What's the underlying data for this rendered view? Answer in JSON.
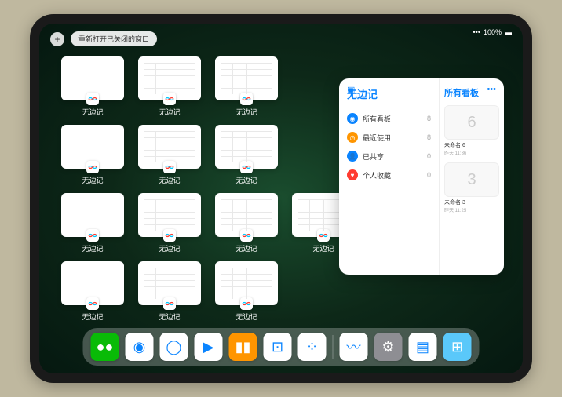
{
  "status": {
    "battery": "100%",
    "signal": "●●●●"
  },
  "topbar": {
    "plus": "+",
    "reopen": "重新打开已关闭的窗口"
  },
  "app": {
    "name": "无边记"
  },
  "windows": [
    {
      "label": "无边记",
      "style": "blank"
    },
    {
      "label": "无边记",
      "style": "lines"
    },
    {
      "label": "无边记",
      "style": "lines"
    },
    {
      "label": "无边记",
      "style": "blank"
    },
    {
      "label": "无边记",
      "style": "lines"
    },
    {
      "label": "无边记",
      "style": "lines"
    },
    {
      "label": "无边记",
      "style": "blank"
    },
    {
      "label": "无边记",
      "style": "lines"
    },
    {
      "label": "无边记",
      "style": "lines"
    },
    {
      "label": "无边记",
      "style": "lines"
    },
    {
      "label": "无边记",
      "style": "blank"
    },
    {
      "label": "无边记",
      "style": "lines"
    },
    {
      "label": "无边记",
      "style": "lines"
    }
  ],
  "panel": {
    "title": "无边记",
    "rightTitle": "所有看板",
    "categories": [
      {
        "label": "所有看板",
        "count": "8",
        "color": "#0a84ff",
        "icon": "◉"
      },
      {
        "label": "最近使用",
        "count": "8",
        "color": "#ff9500",
        "icon": "◷"
      },
      {
        "label": "已共享",
        "count": "0",
        "color": "#0a84ff",
        "icon": "👤"
      },
      {
        "label": "个人收藏",
        "count": "0",
        "color": "#ff3b30",
        "icon": "♥"
      }
    ],
    "boards": [
      {
        "name": "未命名 6",
        "date": "昨天 11:36",
        "glyph": "6"
      },
      {
        "name": "未命名 3",
        "date": "昨天 11:25",
        "glyph": "3"
      }
    ]
  },
  "dock": {
    "apps": [
      {
        "name": "wechat",
        "bg": "#09bb07",
        "glyph": "●●"
      },
      {
        "name": "browser",
        "bg": "#fff",
        "glyph": "◉"
      },
      {
        "name": "qq-browser",
        "bg": "#fff",
        "glyph": "◯"
      },
      {
        "name": "youku",
        "bg": "#fff",
        "glyph": "▶"
      },
      {
        "name": "books",
        "bg": "#ff9500",
        "glyph": "▮▮"
      },
      {
        "name": "app1",
        "bg": "#fff",
        "glyph": "⊡"
      },
      {
        "name": "app2",
        "bg": "#fff",
        "glyph": "⁘"
      },
      {
        "name": "freeform",
        "bg": "#fff",
        "glyph": "〰"
      },
      {
        "name": "settings",
        "bg": "#8e8e93",
        "glyph": "⚙"
      },
      {
        "name": "notes",
        "bg": "#fff",
        "glyph": "▤"
      },
      {
        "name": "folder",
        "bg": "#5ac8fa",
        "glyph": "⊞"
      }
    ]
  }
}
